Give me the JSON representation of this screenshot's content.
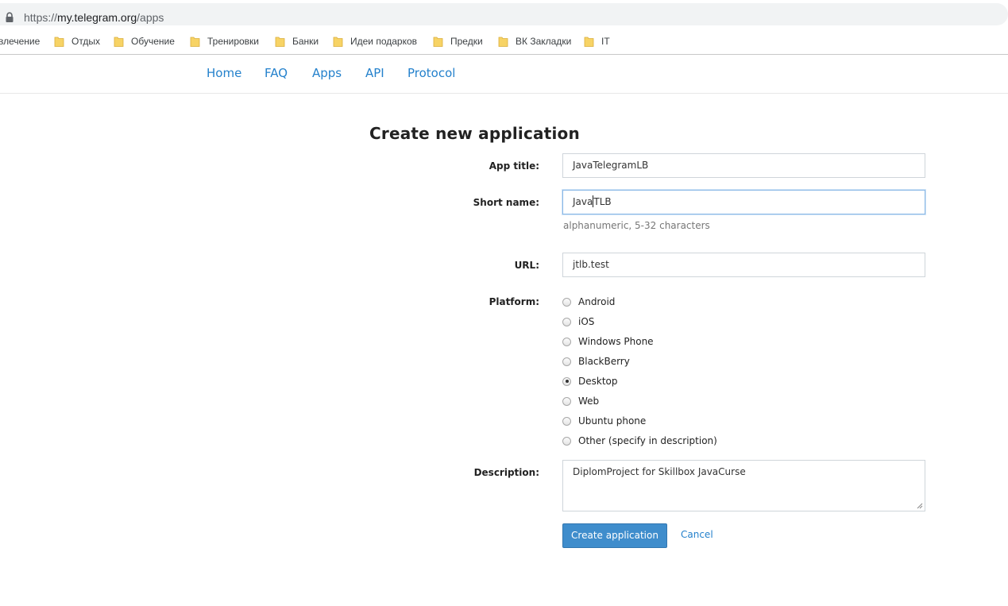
{
  "browser": {
    "url_prefix": "https://",
    "url_host": "my.telegram.org",
    "url_path": "/apps",
    "bookmarks": [
      "влечение",
      "Отдых",
      "Обучение",
      "Тренировки",
      "Банки",
      "Идеи подарков",
      "Предки",
      "ВК Закладки",
      "IT"
    ]
  },
  "nav": {
    "items": [
      "Home",
      "FAQ",
      "Apps",
      "API",
      "Protocol"
    ]
  },
  "form": {
    "title": "Create new application",
    "app_title_label": "App title:",
    "app_title_value": "JavaTelegramLB",
    "short_name_label": "Short name:",
    "short_name_value_before_caret": "Java",
    "short_name_value_after_caret": "TLB",
    "short_name_hint": "alphanumeric, 5-32 characters",
    "url_label": "URL:",
    "url_value": "jtlb.test",
    "platform_label": "Platform:",
    "platforms": [
      "Android",
      "iOS",
      "Windows Phone",
      "BlackBerry",
      "Desktop",
      "Web",
      "Ubuntu phone",
      "Other (specify in description)"
    ],
    "platform_selected": "Desktop",
    "description_label": "Description:",
    "description_value": "DiplomProject for Skillbox JavaCurse",
    "submit_label": "Create application",
    "cancel_label": "Cancel"
  },
  "colors": {
    "link": "#2481cc",
    "button": "#3f8dcc",
    "folder": "#f7d365"
  }
}
